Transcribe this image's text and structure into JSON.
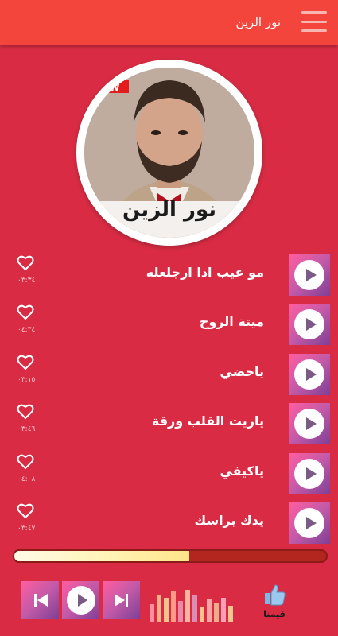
{
  "header": {
    "title": "نور الزين",
    "menu_icon": "hamburger-menu-icon"
  },
  "artist": {
    "caption": "نور الزين"
  },
  "songs": [
    {
      "title": "مو عيب اذا ارجلعله",
      "duration": "٠٣:٣٤"
    },
    {
      "title": "ميتة الروح",
      "duration": "٠٤:٣٤"
    },
    {
      "title": "ياحضي",
      "duration": "٠٣:١٥"
    },
    {
      "title": "ياريت القلب ورقة",
      "duration": "٠٣:٤٦"
    },
    {
      "title": "ياكيفي",
      "duration": "٠٤:٠٨"
    },
    {
      "title": "يدك براسك",
      "duration": "٠٣:٤٧"
    }
  ],
  "player": {
    "progress": 0.56,
    "like_label": "قيمنا",
    "icons": [
      "previous-icon",
      "play-icon",
      "next-icon",
      "equalizer-icon",
      "thumbs-up-icon"
    ]
  },
  "colors": {
    "background": "#d92c44",
    "header": "#f3453c",
    "button_gradient": [
      "#ff5ea0",
      "#7e3f95"
    ]
  }
}
